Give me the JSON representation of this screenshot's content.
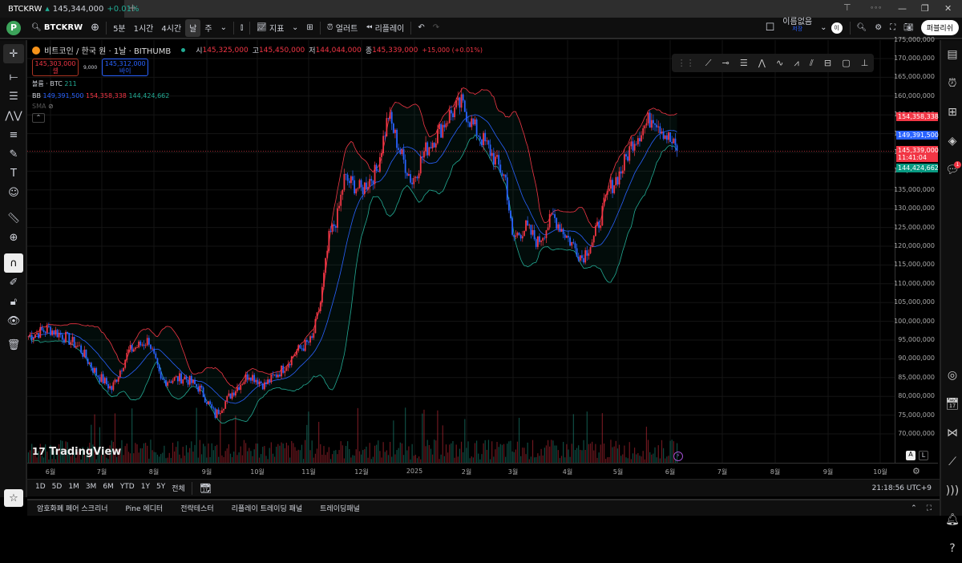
{
  "tab": {
    "symbol": "BTCKRW",
    "price": "145,344,000",
    "change": "+0.01%",
    "add": "+"
  },
  "window": {
    "min": "—",
    "max": "❐",
    "close": "✕",
    "more": "∘∘∘"
  },
  "toolbar": {
    "profile": "P",
    "symbol": "BTCKRW",
    "intervals": [
      "5분",
      "1시간",
      "4시간",
      "날",
      "주"
    ],
    "active_interval": "날",
    "indicators": "지표",
    "alert": "얼러트",
    "replay": "리플레이",
    "layout_name": "이름없음",
    "layout_sub": "저장",
    "avatar": "이",
    "publish": "퍼블리쉬"
  },
  "legend": {
    "title": "비트코인 / 한국 원 · 1날 · BITHUMB",
    "o_label": "시",
    "o": "145,325,000",
    "h_label": "고",
    "h": "145,450,000",
    "l_label": "저",
    "l": "144,044,000",
    "c_label": "종",
    "c": "145,339,000",
    "chg": "+15,000 (+0.01%)",
    "sell_price": "145,303,000",
    "sell_label": "셀",
    "spread": "9,000",
    "buy_price": "145,312,000",
    "buy_label": "바이",
    "volume_label": "볼륨 · BTC",
    "volume_value": "211",
    "bb_label": "BB",
    "bb_basis": "149,391,500",
    "bb_upper": "154,358,338",
    "bb_lower": "144,424,662",
    "sma_label": "SMA"
  },
  "price_axis": {
    "labels": [
      "175,000,000",
      "170,000,000",
      "165,000,000",
      "160,000,000",
      "155,000,000",
      "150,000,000",
      "145,000,000",
      "140,000,000",
      "135,000,000",
      "130,000,000",
      "125,000,000",
      "120,000,000",
      "115,000,000",
      "110,000,000",
      "105,000,000",
      "100,000,000",
      "95,000,000",
      "90,000,000",
      "85,000,000",
      "80,000,000",
      "75,000,000",
      "70,000,000"
    ],
    "tags": {
      "upper": "154,358,338",
      "basis": "149,391,500",
      "last": "145,339,000",
      "countdown": "11:41:04",
      "lower": "144,424,662"
    }
  },
  "time_axis": {
    "labels": [
      "6월",
      "7월",
      "8월",
      "9월",
      "10월",
      "11월",
      "12월",
      "2025",
      "2월",
      "3월",
      "4월",
      "5월",
      "6월",
      "7월",
      "8월",
      "9월",
      "10월"
    ]
  },
  "scale_buttons": {
    "auto": "A",
    "log": "L"
  },
  "ranges": [
    "1D",
    "5D",
    "1M",
    "3M",
    "6M",
    "YTD",
    "1Y",
    "5Y",
    "전체"
  ],
  "clock": "21:18:56 UTC+9",
  "bottom_tabs": [
    "암호화폐 페어 스크리너",
    "Pine 에디터",
    "전략테스터",
    "리플레이 트레이딩 패널",
    "트레이딩패널"
  ],
  "watermark": "TradingView",
  "notification_count": "1",
  "colors": {
    "up": "#f23645",
    "down": "#2962ff",
    "bb_upper": "#f23645",
    "bb_lower": "#22ab94",
    "bb_basis": "#2962ff"
  },
  "chart_data": {
    "type": "candlestick",
    "unit": "KRW",
    "ylim": [
      65000000,
      177000000
    ],
    "close_anchors": [
      [
        "2024-05-19",
        96
      ],
      [
        "2024-05-31",
        98
      ],
      [
        "2024-06-09",
        96
      ],
      [
        "2024-06-18",
        93
      ],
      [
        "2024-06-28",
        86
      ],
      [
        "2024-07-07",
        82
      ],
      [
        "2024-07-17",
        92
      ],
      [
        "2024-07-29",
        95
      ],
      [
        "2024-08-05",
        84
      ],
      [
        "2024-08-19",
        85
      ],
      [
        "2024-08-28",
        82
      ],
      [
        "2024-09-06",
        75
      ],
      [
        "2024-09-16",
        81
      ],
      [
        "2024-09-26",
        86
      ],
      [
        "2024-10-05",
        83
      ],
      [
        "2024-10-15",
        87
      ],
      [
        "2024-10-24",
        92
      ],
      [
        "2024-11-02",
        95
      ],
      [
        "2024-11-07",
        105
      ],
      [
        "2024-11-12",
        122
      ],
      [
        "2024-11-17",
        128
      ],
      [
        "2024-11-21",
        138
      ],
      [
        "2024-12-01",
        135
      ],
      [
        "2024-12-10",
        140
      ],
      [
        "2024-12-17",
        155
      ],
      [
        "2024-12-24",
        145
      ],
      [
        "2024-12-31",
        137
      ],
      [
        "2025-01-07",
        145
      ],
      [
        "2025-01-15",
        150
      ],
      [
        "2025-01-22",
        155
      ],
      [
        "2025-01-29",
        158
      ],
      [
        "2025-02-05",
        152
      ],
      [
        "2025-02-14",
        146
      ],
      [
        "2025-02-24",
        138
      ],
      [
        "2025-02-28",
        122
      ],
      [
        "2025-03-08",
        125
      ],
      [
        "2025-03-15",
        121
      ],
      [
        "2025-03-24",
        128
      ],
      [
        "2025-04-02",
        122
      ],
      [
        "2025-04-10",
        117
      ],
      [
        "2025-04-17",
        122
      ],
      [
        "2025-04-26",
        135
      ],
      [
        "2025-05-03",
        140
      ],
      [
        "2025-05-10",
        148
      ],
      [
        "2025-05-17",
        152
      ],
      [
        "2025-05-22",
        155
      ],
      [
        "2025-05-29",
        150
      ],
      [
        "2025-06-05",
        145.339
      ]
    ],
    "anchor_unit": "million KRW",
    "bollinger": {
      "length": 20,
      "mult": 2
    }
  }
}
